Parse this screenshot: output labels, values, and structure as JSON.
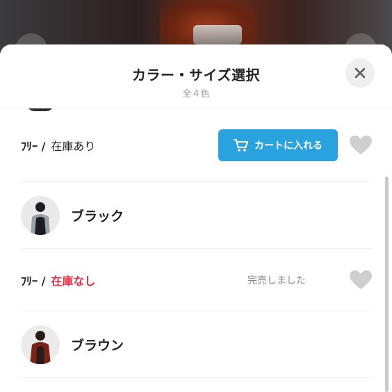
{
  "sheet": {
    "title": "カラー・サイズ選択",
    "subtitle": "全４色",
    "close_icon": "close-icon"
  },
  "rows": [
    {
      "kind": "size",
      "size": "ﾌﾘｰ /",
      "stock": "在庫あり",
      "available": true,
      "cart_label": "カートに入れる",
      "cart_icon": "cart-icon",
      "favorite_icon": "heart-icon"
    },
    {
      "kind": "color",
      "name": "ブラック",
      "thumb_colors": [
        "#1c1c22",
        "#9aa0a8"
      ]
    },
    {
      "kind": "size",
      "size": "ﾌﾘｰ /",
      "stock": "在庫なし",
      "available": false,
      "status": "完売しました",
      "favorite_icon": "heart-icon"
    },
    {
      "kind": "color",
      "name": "ブラウン",
      "thumb_colors": [
        "#2a1a18",
        "#7a2418"
      ]
    }
  ],
  "colors": {
    "accent": "#2aa2dd",
    "soldout": "#e0304a",
    "muted": "#888888",
    "heart": "#cfcfcf"
  }
}
